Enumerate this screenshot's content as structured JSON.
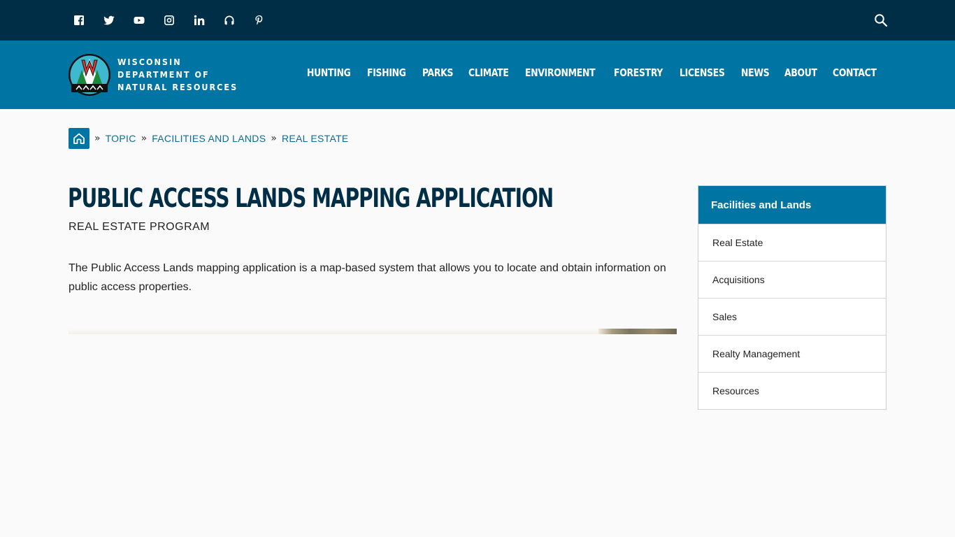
{
  "social": [
    {
      "icon": "facebook-icon"
    },
    {
      "icon": "twitter-icon"
    },
    {
      "icon": "youtube-icon"
    },
    {
      "icon": "instagram-icon"
    },
    {
      "icon": "linkedin-icon"
    },
    {
      "icon": "podcast-icon"
    },
    {
      "icon": "pinterest-icon"
    }
  ],
  "header": {
    "org_line1": "WISCONSIN",
    "org_line2": "DEPARTMENT OF",
    "org_line3": "NATURAL RESOURCES",
    "nav": [
      "HUNTING",
      "FISHING",
      "PARKS",
      "CLIMATE",
      "ENVIRONMENT",
      "FORESTRY",
      "LICENSES",
      "NEWS",
      "ABOUT",
      "CONTACT"
    ]
  },
  "breadcrumb": {
    "sep": "»",
    "items": [
      "TOPIC",
      "FACILITIES AND LANDS",
      "REAL ESTATE"
    ]
  },
  "main": {
    "title": "PUBLIC ACCESS LANDS MAPPING APPLICATION",
    "subtitle": "REAL ESTATE PROGRAM",
    "intro": "The Public Access Lands mapping application is a map-based system that allows you to locate and obtain information on public access properties."
  },
  "sidebar": {
    "heading": "Facilities and Lands",
    "items": [
      "Real Estate",
      "Acquisitions",
      "Sales",
      "Realty Management",
      "Resources"
    ]
  },
  "colors": {
    "topbar": "#012e47",
    "header": "#0075a3",
    "title": "#012e47",
    "link": "#0b6d97"
  }
}
